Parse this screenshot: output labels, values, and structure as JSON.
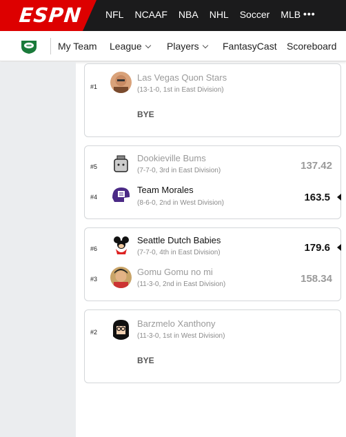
{
  "header": {
    "logo_text": "ESPN",
    "sports": [
      "NFL",
      "NCAAF",
      "NBA",
      "NHL",
      "Soccer",
      "MLB"
    ],
    "more": "•••",
    "brand_color": "#dd0000",
    "bar_color": "#1b1b1c"
  },
  "subnav": {
    "my_team": "My Team",
    "league": "League",
    "players": "Players",
    "fantasycast": "FantasyCast",
    "scoreboard": "Scoreboard"
  },
  "matchups": [
    {
      "bye": true,
      "bye_label": "BYE",
      "teams": [
        {
          "rank": "#1",
          "name": "Las Vegas Quon Stars",
          "record": "(13-1-0, 1st in East Division)",
          "score": "",
          "winner": false
        }
      ]
    },
    {
      "bye": false,
      "teams": [
        {
          "rank": "#5",
          "name": "Dookieville Bums",
          "record": "(7-7-0, 3rd in East Division)",
          "score": "137.42",
          "winner": false
        },
        {
          "rank": "#4",
          "name": "Team Morales",
          "record": "(8-6-0, 2nd in West Division)",
          "score": "163.5",
          "winner": true
        }
      ]
    },
    {
      "bye": false,
      "teams": [
        {
          "rank": "#6",
          "name": "Seattle Dutch Babies",
          "record": "(7-7-0, 4th in East Division)",
          "score": "179.6",
          "winner": true
        },
        {
          "rank": "#3",
          "name": "Gomu Gomu no mi",
          "record": "(11-3-0, 2nd in East Division)",
          "score": "158.34",
          "winner": false
        }
      ]
    },
    {
      "bye": true,
      "bye_label": "BYE",
      "teams": [
        {
          "rank": "#2",
          "name": "Barzmelo Xanthony",
          "record": "(11-3-0, 1st in West Division)",
          "score": "",
          "winner": false
        }
      ]
    }
  ]
}
